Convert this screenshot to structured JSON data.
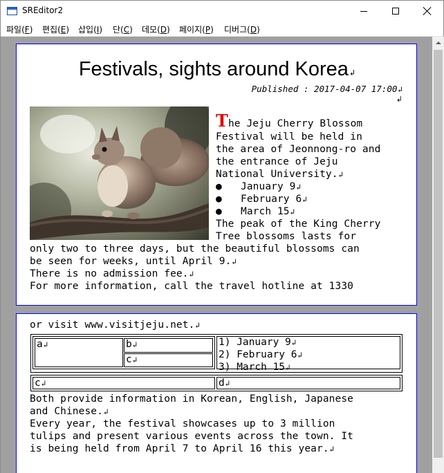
{
  "window": {
    "title": "SREditor2"
  },
  "menu": [
    {
      "label": "파일",
      "accel": "F"
    },
    {
      "label": "편집",
      "accel": "E"
    },
    {
      "label": "삽입",
      "accel": "I"
    },
    {
      "label": "단",
      "accel": "C"
    },
    {
      "label": "데모",
      "accel": "D"
    },
    {
      "label": "페이지",
      "accel": "P"
    },
    {
      "label": "디버그",
      "accel": "D"
    }
  ],
  "document": {
    "title": "Festivals, sights around Korea",
    "published": "Published : 2017-04-07 17:00",
    "paragraph_mark": "↲",
    "image_alt": "squirrel photo",
    "dropcap": "T",
    "lines_right": [
      "he Jeju Cherry Blossom",
      "Festival will be held in",
      "the area of Jeonnong-ro and",
      "the entrance of Jeju",
      "National University."
    ],
    "bullet_symbol": "●",
    "bullets": [
      "January 9",
      "February 6",
      "March 15"
    ],
    "lines_after": [
      "The peak of the King Cherry",
      "Tree blossoms lasts for"
    ],
    "lines_full": [
      "only two to three days, but the beautiful blossoms can",
      "be seen for weeks, until April 9.",
      "There is no admission fee.",
      "For more information, call the travel hotline at 1330"
    ],
    "page2_first": "or visit www.visitjeju.net.",
    "table": {
      "a": "a",
      "b": "b",
      "c_inner": "c",
      "numbered": [
        "1)  January 9",
        "2)  February 6",
        "3)  March 15"
      ],
      "c_bottom": "c",
      "d": "d"
    },
    "page2_lines": [
      "Both provide information in Korean, English, Japanese",
      "and Chinese.",
      "Every year, the festival showcases up to 3 million",
      "tulips and present various events across the town. It",
      "is being held from April 7 to April 16 this year."
    ]
  },
  "colors": {
    "dropcap": "#e00000",
    "page_border": "#0000ff",
    "desk": "#a0a0a0"
  }
}
